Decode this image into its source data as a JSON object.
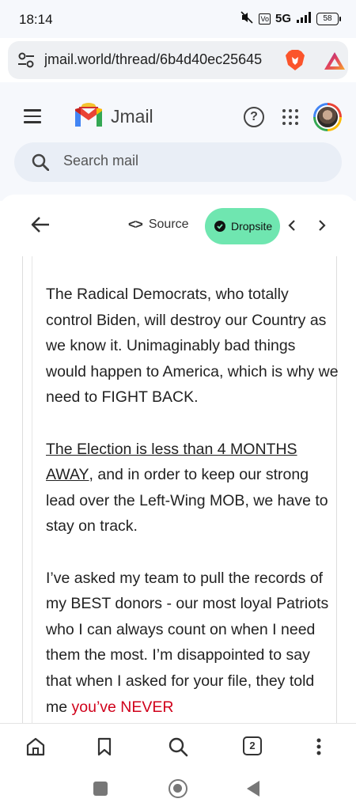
{
  "status_bar": {
    "time": "18:14",
    "network": "5G",
    "battery": "58"
  },
  "browser": {
    "url": "jmail.world/thread/6b4d40ec25645"
  },
  "app": {
    "name": "Jmail",
    "help_label": "?",
    "search_placeholder": "Search mail"
  },
  "toolbar": {
    "source_glyph": "<>",
    "source_label": "Source",
    "dropsite_label": "Dropsite"
  },
  "email": {
    "p1": "The Radical Democrats, who totally control Biden, will destroy our Country as we know it. Unimaginably bad things would happen to America, which is why we need to FIGHT BACK.",
    "p2_underlined": "The Election is less than 4 MONTHS AWAY",
    "p2_rest": ", and in order to keep our strong lead over the Left-Wing MOB, we have to stay on track.",
    "p3_main": "I’ve asked my team to pull the records of my BEST donors - our most loyal Patriots who I can always count on when I need them the most. I’m disappointed to say that when I asked for your file, they told me ",
    "p3_red": "you’ve NEVER"
  },
  "bottom_nav": {
    "tab_count": "2"
  },
  "colors": {
    "dropsite_bg": "#6fe6b0",
    "emphasis_red": "#d0021b",
    "app_bg": "#f6f8fc"
  }
}
